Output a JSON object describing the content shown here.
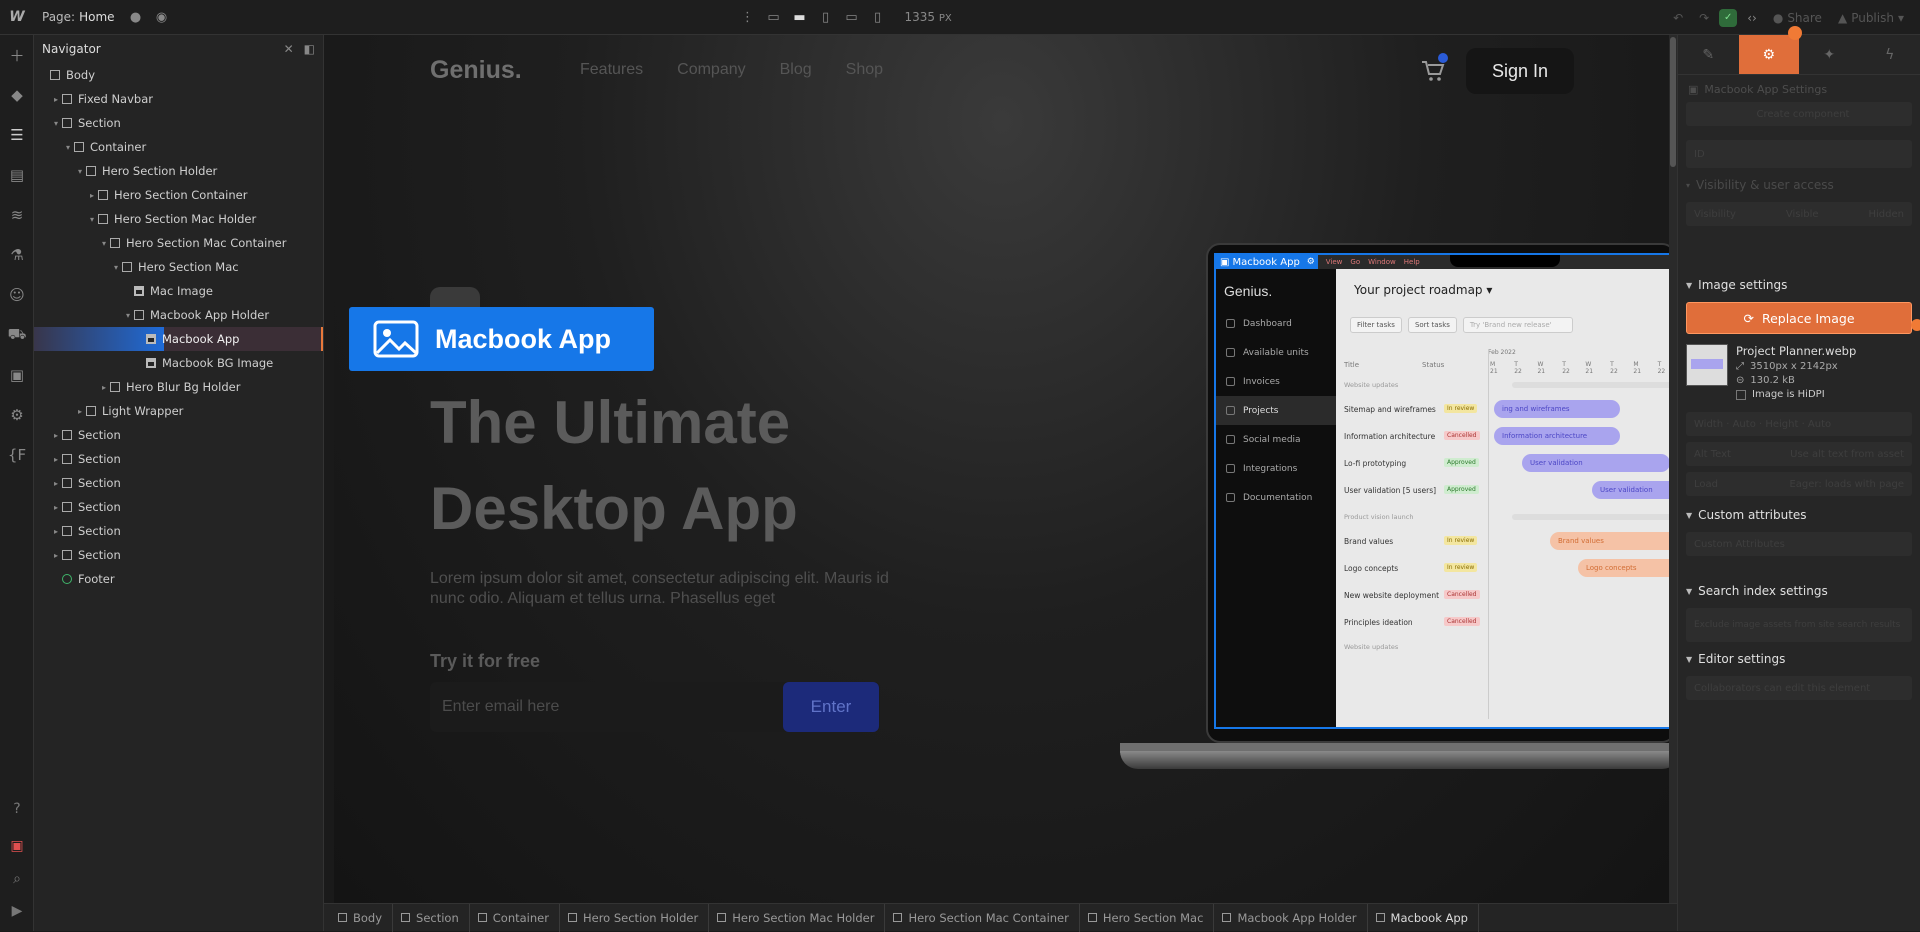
{
  "topbar": {
    "logo": "W",
    "page_label": "Page:",
    "page_name": "Home",
    "width_value": "1335",
    "width_unit": "PX",
    "share_label": "Share",
    "publish_label": "Publish"
  },
  "navigator": {
    "title": "Navigator",
    "items": [
      {
        "label": "Body",
        "depth": 0,
        "kind": "box",
        "arrow": ""
      },
      {
        "label": "Fixed Navbar",
        "depth": 1,
        "kind": "box",
        "arrow": "▸"
      },
      {
        "label": "Section",
        "depth": 1,
        "kind": "box",
        "arrow": "▾"
      },
      {
        "label": "Container",
        "depth": 2,
        "kind": "box",
        "arrow": "▾"
      },
      {
        "label": "Hero Section Holder",
        "depth": 3,
        "kind": "box",
        "arrow": "▾"
      },
      {
        "label": "Hero Section Container",
        "depth": 4,
        "kind": "box",
        "arrow": "▸"
      },
      {
        "label": "Hero Section Mac Holder",
        "depth": 4,
        "kind": "box",
        "arrow": "▾"
      },
      {
        "label": "Hero Section Mac Container",
        "depth": 5,
        "kind": "box",
        "arrow": "▾"
      },
      {
        "label": "Hero Section Mac",
        "depth": 6,
        "kind": "box",
        "arrow": "▾"
      },
      {
        "label": "Mac Image",
        "depth": 7,
        "kind": "img",
        "arrow": ""
      },
      {
        "label": "Macbook App Holder",
        "depth": 7,
        "kind": "box",
        "arrow": "▾"
      },
      {
        "label": "Macbook App",
        "depth": 8,
        "kind": "img",
        "arrow": "",
        "selected": true
      },
      {
        "label": "Macbook BG Image",
        "depth": 8,
        "kind": "img",
        "arrow": ""
      },
      {
        "label": "Hero Blur Bg Holder",
        "depth": 5,
        "kind": "box",
        "arrow": "▸"
      },
      {
        "label": "Light Wrapper",
        "depth": 3,
        "kind": "box",
        "arrow": "▸"
      },
      {
        "label": "Section",
        "depth": 1,
        "kind": "box",
        "arrow": "▸"
      },
      {
        "label": "Section",
        "depth": 1,
        "kind": "box",
        "arrow": "▸"
      },
      {
        "label": "Section",
        "depth": 1,
        "kind": "box",
        "arrow": "▸"
      },
      {
        "label": "Section",
        "depth": 1,
        "kind": "box",
        "arrow": "▸"
      },
      {
        "label": "Section",
        "depth": 1,
        "kind": "box",
        "arrow": "▸"
      },
      {
        "label": "Section",
        "depth": 1,
        "kind": "box",
        "arrow": "▸"
      },
      {
        "label": "Footer",
        "depth": 1,
        "kind": "component",
        "arrow": ""
      }
    ]
  },
  "site": {
    "logo": "Genius.",
    "nav": [
      "Features",
      "Company",
      "Blog",
      "Shop"
    ],
    "sign_in": "Sign In",
    "selected_badge": "Macbook App",
    "hero_title": "The Ultimate Desktop App",
    "hero_sub": "Lorem ipsum dolor sit amet, consectetur adipiscing elit. Mauris id nunc odio. Aliquam et tellus urna. Phasellus eget",
    "try_label": "Try it for free",
    "email_placeholder": "Enter email here",
    "enter_label": "Enter"
  },
  "mac_app": {
    "menubar_tag": "Macbook App",
    "menus": [
      "View",
      "Go",
      "Window",
      "Help"
    ],
    "brand": "Genius.",
    "sidebar": [
      "Dashboard",
      "Available units",
      "Invoices",
      "Projects",
      "Social media",
      "Integrations",
      "Documentation"
    ],
    "active_sidebar": "Projects",
    "title": "Your project roadmap",
    "chips": [
      "Filter tasks",
      "Sort tasks",
      "Try 'Brand new release'"
    ],
    "col_title": "Title",
    "col_status": "Status",
    "month": "Feb 2022",
    "ticks": [
      "M 21",
      "T 22",
      "W 21",
      "T 22",
      "W 21",
      "T 22",
      "M 21",
      "T 22",
      "T 22"
    ],
    "section1": "Website updates",
    "section2": "Product vision launch",
    "section3": "Website updates",
    "rows1": [
      {
        "name": "Sitemap and wireframes",
        "status": "In review",
        "cls": "ip",
        "bar": "ing and wireframes"
      },
      {
        "name": "Information architecture",
        "status": "Cancelled",
        "cls": "ca",
        "bar": "Information architecture"
      },
      {
        "name": "Lo-fi prototyping",
        "status": "Approved",
        "cls": "ap",
        "bar": "User validation"
      },
      {
        "name": "User validation [5 users]",
        "status": "Approved",
        "cls": "ap",
        "bar": "User validation"
      }
    ],
    "rows2": [
      {
        "name": "Brand values",
        "status": "In review",
        "cls": "ip",
        "bar": "Brand values"
      },
      {
        "name": "Logo concepts",
        "status": "In review",
        "cls": "ip",
        "bar": "Logo concepts"
      },
      {
        "name": "New website deployment",
        "status": "Cancelled",
        "cls": "ca",
        "bar": ""
      },
      {
        "name": "Principles ideation",
        "status": "Cancelled",
        "cls": "ca",
        "bar": ""
      }
    ]
  },
  "right_panel": {
    "element_settings": "Macbook App Settings",
    "create_component": "Create component",
    "id_label": "ID",
    "visibility_header": "Visibility & user access",
    "visibility_label": "Visibility",
    "visible": "Visible",
    "hidden": "Hidden",
    "image_settings": "Image settings",
    "replace_image": "Replace Image",
    "file_name": "Project Planner.webp",
    "dimensions": "3510px x 2142px",
    "file_size": "130.2 kB",
    "hidpi": "Image is HiDPI",
    "alt_label": "Alt Text",
    "alt_value": "Use alt text from asset",
    "load_label": "Load",
    "load_value": "Eager: loads with page",
    "custom_attributes": "Custom attributes",
    "custom_attr_row": "Custom Attributes",
    "search_index": "Search index settings",
    "search_index_row": "Exclude image assets from site search results",
    "editor_settings": "Editor settings",
    "editor_row": "Collaborators can edit this element"
  },
  "breadcrumb": [
    "Body",
    "Section",
    "Container",
    "Hero Section Holder",
    "Hero Section Mac Holder",
    "Hero Section Mac Container",
    "Hero Section Mac",
    "Macbook App Holder",
    "Macbook App"
  ]
}
